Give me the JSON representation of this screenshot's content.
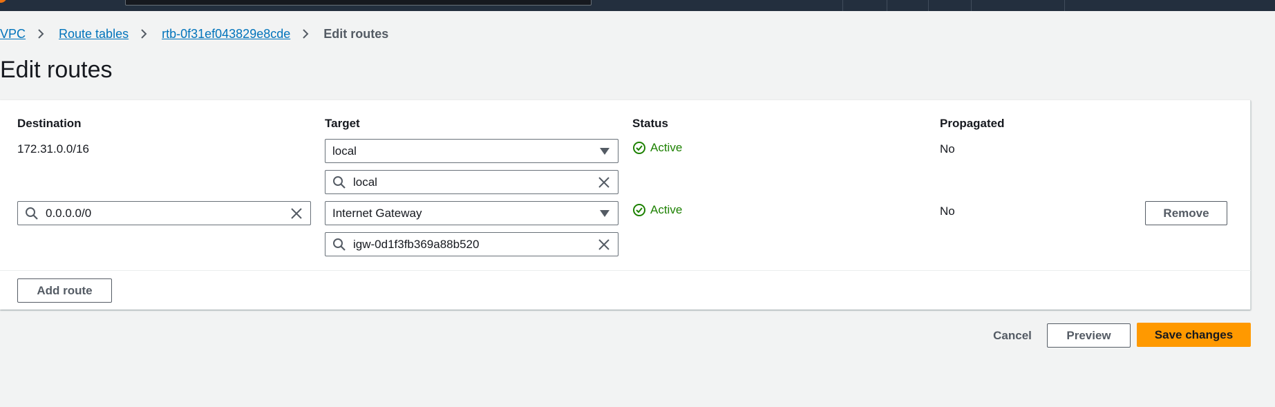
{
  "breadcrumb": {
    "items": [
      "VPC",
      "Route tables",
      "rtb-0f31ef043829e8cde"
    ],
    "current": "Edit routes"
  },
  "page": {
    "title": "Edit routes"
  },
  "table": {
    "headers": {
      "destination": "Destination",
      "target": "Target",
      "status": "Status",
      "propagated": "Propagated"
    },
    "rows": [
      {
        "destination": "172.31.0.0/16",
        "target_type": "local",
        "target_value": "local",
        "status": "Active",
        "propagated": "No"
      },
      {
        "destination": "0.0.0.0/0",
        "target_type": "Internet Gateway",
        "target_value": "igw-0d1f3fb369a88b520",
        "status": "Active",
        "propagated": "No",
        "remove_label": "Remove"
      }
    ]
  },
  "actions": {
    "add_route": "Add route",
    "cancel": "Cancel",
    "preview": "Preview",
    "save": "Save changes"
  },
  "colors": {
    "link": "#0073bb",
    "status_ok": "#1d8102",
    "primary": "#ff9900",
    "topbar": "#232f3e"
  }
}
